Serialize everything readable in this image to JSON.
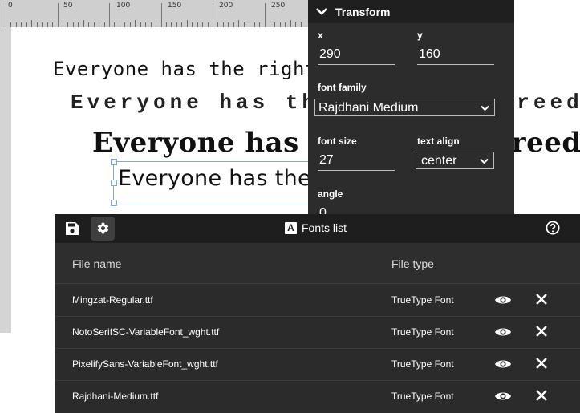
{
  "ruler": {
    "labels": [
      "0",
      "50",
      "100",
      "150",
      "200",
      "250"
    ]
  },
  "canvas": {
    "sample_text": "Everyone has the right to freedom"
  },
  "transform": {
    "title": "Transform",
    "x_label": "x",
    "x_value": "290",
    "y_label": "y",
    "y_value": "160",
    "font_family_label": "font family",
    "font_family_value": "Rajdhani Medium",
    "font_size_label": "font size",
    "font_size_value": "27",
    "text_align_label": "text align",
    "text_align_value": "center",
    "angle_label": "angle",
    "angle_value": "0"
  },
  "fonts_dialog": {
    "title": "Fonts list",
    "title_icon_letter": "A",
    "columns": {
      "name": "File name",
      "type": "File type"
    },
    "rows": [
      {
        "name": "Mingzat-Regular.ttf",
        "type": "TrueType Font"
      },
      {
        "name": "NotoSerifSC-VariableFont_wght.ttf",
        "type": "TrueType Font"
      },
      {
        "name": "PixelifySans-VariableFont_wght.ttf",
        "type": "TrueType Font"
      },
      {
        "name": "Rajdhani-Medium.ttf",
        "type": "TrueType Font"
      }
    ]
  },
  "icons": {
    "save": "save-icon",
    "settings": "gear-icon",
    "help": "help-icon",
    "preview": "eye-icon",
    "remove": "close-icon",
    "collapse": "chevron-down-icon"
  },
  "colors": {
    "panel_bg": "#2c2c2c",
    "toolbar_bg": "#1e1e1e",
    "dialog_bg": "#2b2b2b",
    "selection": "#7fa8e6"
  }
}
